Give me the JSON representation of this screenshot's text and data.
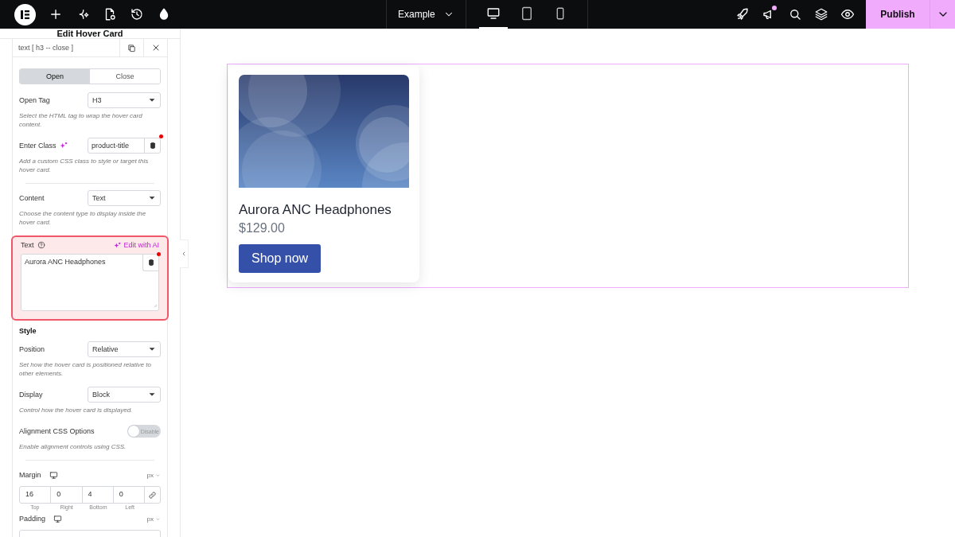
{
  "topbar": {
    "site_menu": "Example",
    "devices": [
      {
        "kind": "desktop",
        "selected": true
      },
      {
        "kind": "tablet",
        "selected": false
      },
      {
        "kind": "mobile",
        "selected": false
      }
    ],
    "notification": true,
    "publish": "Publish"
  },
  "panel": {
    "title": "Edit Hover Card",
    "element_label": "text [ h3 -- close ]",
    "tabs": [
      {
        "label": "Open",
        "selected": true
      },
      {
        "label": "Close",
        "selected": false
      }
    ],
    "controls": [
      {
        "kind": "select",
        "label": "Open Tag",
        "value": "H3",
        "description": "Select the HTML tag to wrap the hover card content."
      },
      {
        "kind": "text",
        "label": "Enter Class",
        "ai": true,
        "value": "product-title",
        "dynamic": true,
        "description": "Add a custom CSS class to style or target this hover card."
      },
      {
        "kind": "divider"
      },
      {
        "kind": "select",
        "label": "Content",
        "value": "Text",
        "description": "Choose the content type to display inside the hover card."
      },
      {
        "kind": "textarea",
        "label": "Text",
        "help": true,
        "ai_action": "Edit with AI",
        "value": "Aurora ANC Headphones",
        "highlighted": true,
        "dynamic": true
      },
      {
        "kind": "heading",
        "label": "Style"
      },
      {
        "kind": "select",
        "label": "Position",
        "value": "Relative",
        "description": "Set how the hover card is positioned relative to other elements."
      },
      {
        "kind": "select",
        "label": "Display",
        "value": "Block",
        "description": "Control how the hover card is displayed."
      },
      {
        "kind": "switch",
        "label": "Alignment CSS Options",
        "on": false,
        "state_label": "Disable",
        "description": "Enable alignment controls using CSS."
      },
      {
        "kind": "divider"
      },
      {
        "kind": "dimensions",
        "label": "Margin",
        "unit": "px",
        "fields": [
          {
            "value": "16",
            "label": "Top"
          },
          {
            "value": "0",
            "label": "Right"
          },
          {
            "value": "4",
            "label": "Bottom"
          },
          {
            "value": "0",
            "label": "Left"
          }
        ]
      },
      {
        "kind": "dimensions",
        "label": "Padding",
        "unit": "px"
      }
    ]
  },
  "canvas": {
    "card": {
      "title": "Aurora ANC Headphones",
      "price": "$129.00",
      "button": "Shop now"
    }
  }
}
